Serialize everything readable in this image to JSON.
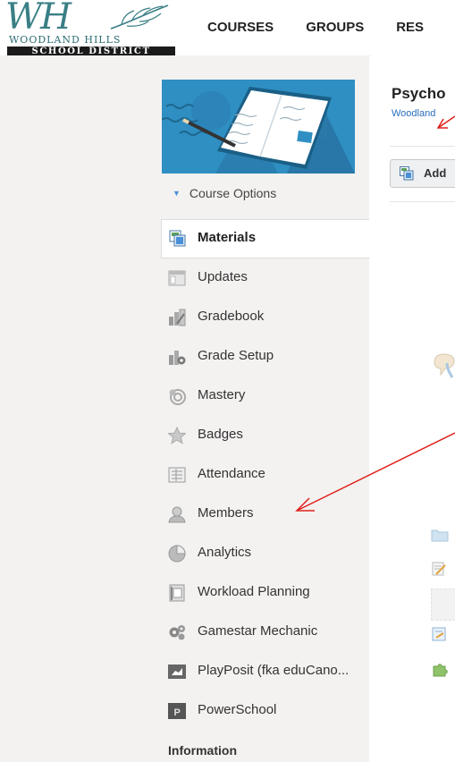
{
  "logo": {
    "mark": "WH",
    "name": "WOODLAND HILLS",
    "band": "SCHOOL DISTRICT"
  },
  "topnav": [
    "COURSES",
    "GROUPS",
    "RES"
  ],
  "course_options": "Course Options",
  "menu": [
    {
      "label": "Materials",
      "icon": "materials-icon",
      "active": true
    },
    {
      "label": "Updates",
      "icon": "updates-icon"
    },
    {
      "label": "Gradebook",
      "icon": "gradebook-icon"
    },
    {
      "label": "Grade Setup",
      "icon": "grade-setup-icon"
    },
    {
      "label": "Mastery",
      "icon": "mastery-icon"
    },
    {
      "label": "Badges",
      "icon": "badges-icon"
    },
    {
      "label": "Attendance",
      "icon": "attendance-icon"
    },
    {
      "label": "Members",
      "icon": "members-icon"
    },
    {
      "label": "Analytics",
      "icon": "analytics-icon"
    },
    {
      "label": "Workload Planning",
      "icon": "workload-planning-icon"
    },
    {
      "label": "Gamestar Mechanic",
      "icon": "gamestar-icon"
    },
    {
      "label": "PlayPosit (fka eduCano...",
      "icon": "playposit-icon"
    },
    {
      "label": "PowerSchool",
      "icon": "powerschool-icon"
    }
  ],
  "information": "Information",
  "course": {
    "title": "Psycho",
    "subtitle": "Woodland"
  },
  "add_button": "Add",
  "colors": {
    "accent_blue": "#2f8fc2",
    "link_blue": "#2a6ebb",
    "annotation_red": "#e0201b",
    "sidebar_bg": "#f4f2f1"
  }
}
